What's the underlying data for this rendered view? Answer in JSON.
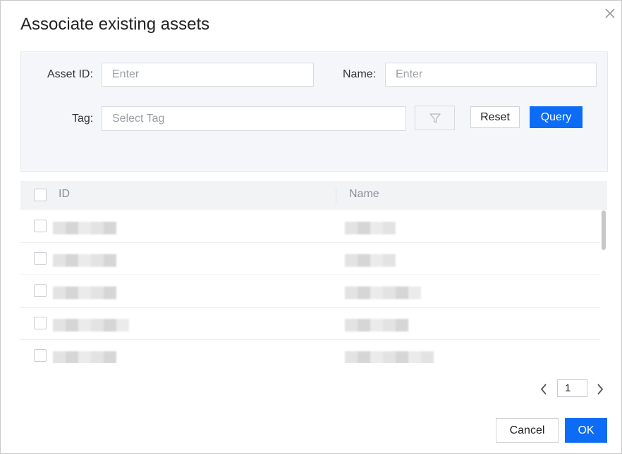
{
  "dialog": {
    "title": "Associate existing assets",
    "close_icon": "close-icon"
  },
  "filters": {
    "asset_id_label": "Asset ID:",
    "asset_id_placeholder": "Enter",
    "name_label": "Name:",
    "name_placeholder": "Enter",
    "tag_label": "Tag:",
    "tag_placeholder": "Select Tag",
    "filter_icon": "funnel-icon",
    "reset_label": "Reset",
    "query_label": "Query"
  },
  "table": {
    "columns": [
      "ID",
      "Name"
    ],
    "row_count": 5
  },
  "pagination": {
    "current_page": "1",
    "prev_icon": "chevron-left-icon",
    "next_icon": "chevron-right-icon"
  },
  "footer": {
    "cancel_label": "Cancel",
    "ok_label": "OK"
  },
  "colors": {
    "primary": "#0c6cf5",
    "panel_bg": "#f4f6f9"
  }
}
